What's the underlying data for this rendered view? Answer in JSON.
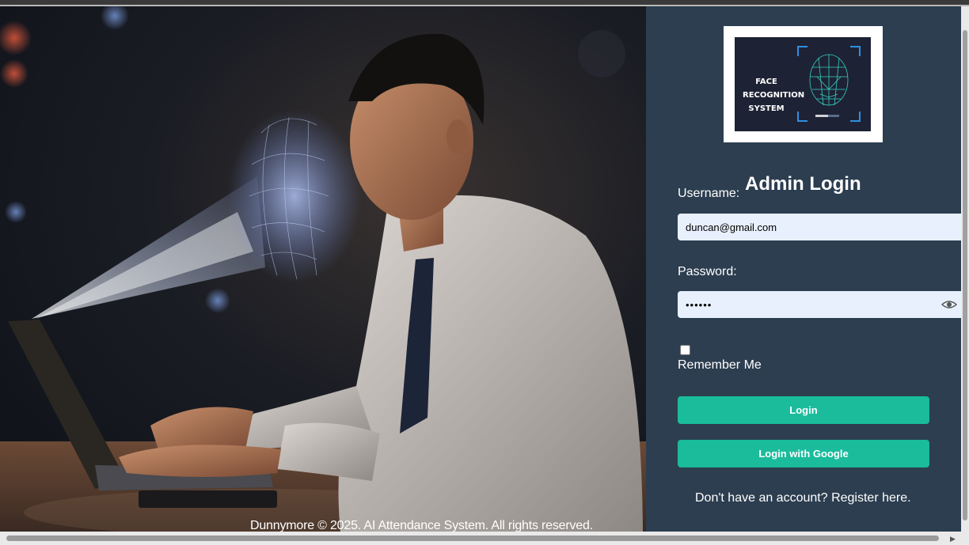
{
  "hero": {
    "image_description_icon": "man-using-laptop-face-scan-illustration",
    "footer": "Dunnymore © 2025. AI Attendance System. All rights reserved."
  },
  "logo": {
    "lines": [
      "FACE",
      "RECOGNITION",
      "SYSTEM"
    ],
    "icon": "face-mesh-scan-icon"
  },
  "login": {
    "title": "Admin Login",
    "username_label": "Username:",
    "username_value": "duncan@gmail.com",
    "password_label": "Password:",
    "password_value": "••••••",
    "remember_label": "Remember Me",
    "login_button": "Login",
    "google_button": "Login with Google",
    "register_text": "Don't have an account? Register here."
  },
  "colors": {
    "panel_bg": "#2c3e50",
    "button_bg": "#1abc9c",
    "input_bg": "#e8f0fe"
  }
}
